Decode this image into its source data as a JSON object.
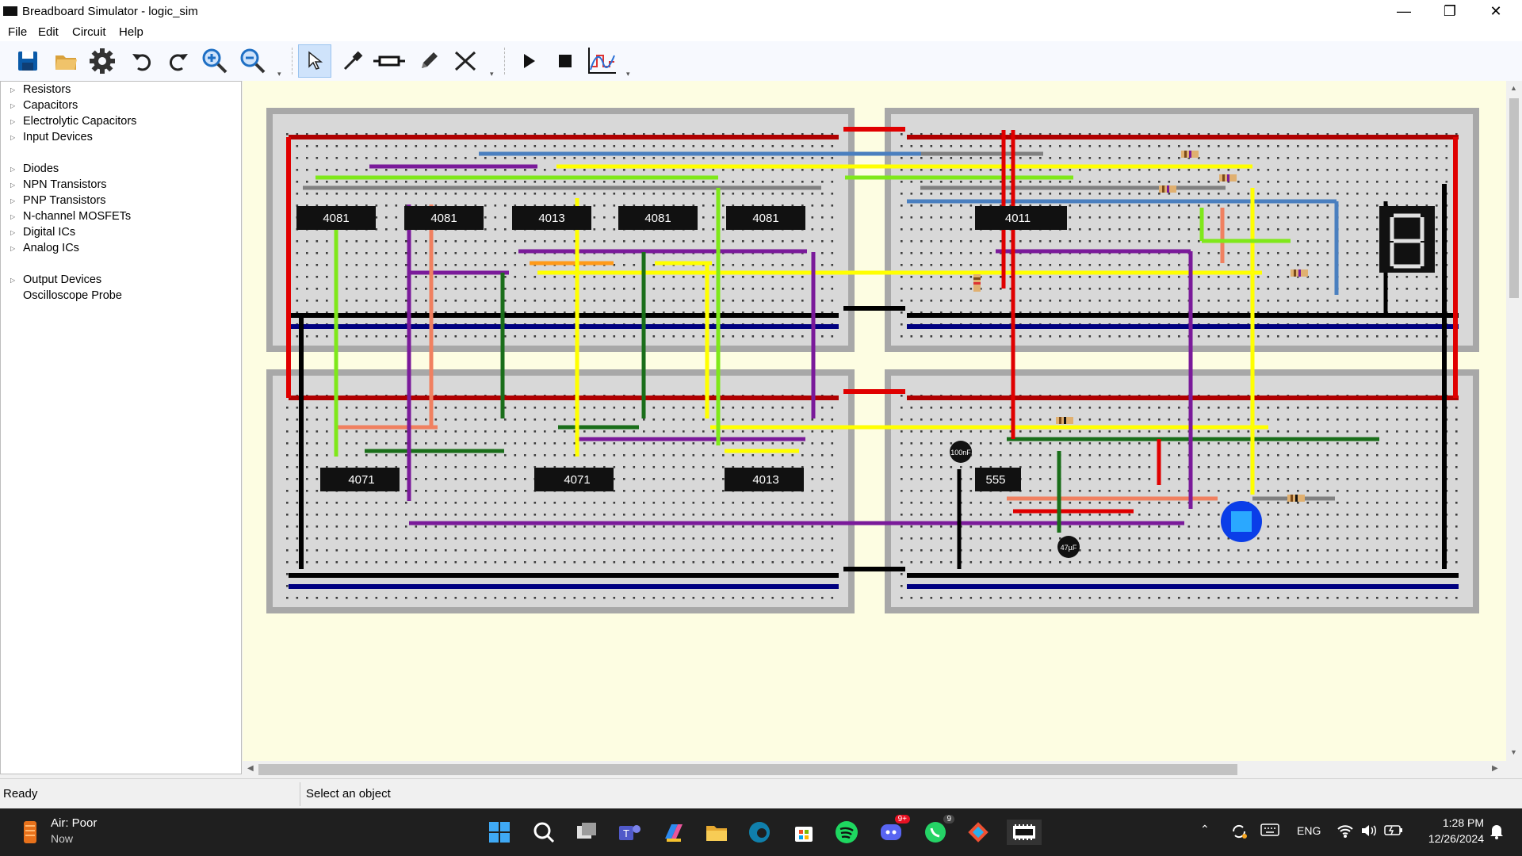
{
  "window": {
    "title": "Breadboard Simulator - logic_sim",
    "minimize": "—",
    "maximize": "❐",
    "close": "✕"
  },
  "menu": [
    "File",
    "Edit",
    "Circuit",
    "Help"
  ],
  "toolbar": {
    "tools": [
      "save-icon",
      "open-folder-icon",
      "settings-gear-icon",
      "undo-icon",
      "redo-icon",
      "zoom-in-icon",
      "zoom-out-icon",
      "select-pointer-icon",
      "probe-icon",
      "resistor-icon",
      "pencil-icon",
      "delete-x-icon",
      "play-icon",
      "stop-icon",
      "graph-icon"
    ],
    "active_tool": "select-pointer-icon"
  },
  "sidebar": {
    "items": [
      {
        "label": "Resistors",
        "expandable": true
      },
      {
        "label": "Capacitors",
        "expandable": true
      },
      {
        "label": "Electrolytic Capacitors",
        "expandable": true
      },
      {
        "label": "Input Devices",
        "expandable": true
      },
      {
        "label": "Diodes",
        "expandable": true
      },
      {
        "label": "NPN Transistors",
        "expandable": true
      },
      {
        "label": "PNP Transistors",
        "expandable": true
      },
      {
        "label": "N-channel MOSFETs",
        "expandable": true
      },
      {
        "label": "Digital ICs",
        "expandable": true
      },
      {
        "label": "Analog ICs",
        "expandable": true
      },
      {
        "label": "Output Devices",
        "expandable": true
      },
      {
        "label": "Oscilloscope Probe",
        "expandable": false
      }
    ]
  },
  "circuit": {
    "chips": [
      {
        "label": "4081"
      },
      {
        "label": "4081"
      },
      {
        "label": "4013"
      },
      {
        "label": "4081"
      },
      {
        "label": "4081"
      },
      {
        "label": "4011"
      },
      {
        "label": "4071"
      },
      {
        "label": "4071"
      },
      {
        "label": "4013"
      },
      {
        "label": "555"
      }
    ],
    "capacitor_labels": [
      "100nF",
      "47µF"
    ],
    "colors": {
      "power": "#c00000",
      "ground": "#000000",
      "gnd_rail": "#000080",
      "board": "#d8d8d8",
      "frame": "#a8a8a8",
      "canvas": "#fdfde2"
    }
  },
  "status": {
    "left": "Ready",
    "right": "Select an object"
  },
  "taskbar": {
    "weather_title": "Air: Poor",
    "weather_sub": "Now",
    "apps": [
      "windows-start-icon",
      "search-icon",
      "task-view-icon",
      "teams-icon",
      "copilot-icon",
      "file-explorer-icon",
      "edge-icon",
      "store-icon",
      "spotify-icon",
      "discord-icon",
      "whatsapp-icon",
      "git-icon",
      "breadboard-app-icon"
    ],
    "discord_badge": "9+",
    "whatsapp_badge": "9",
    "language": "ENG",
    "time": "1:28 PM",
    "date": "12/26/2024"
  }
}
